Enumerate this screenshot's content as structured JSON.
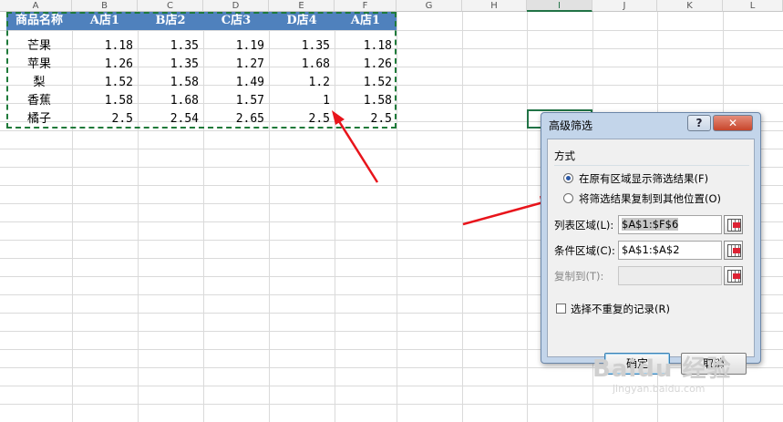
{
  "columns": [
    "A",
    "B",
    "C",
    "D",
    "E",
    "F",
    "G",
    "H",
    "I",
    "J",
    "K",
    "L"
  ],
  "table": {
    "headers": [
      "商品名称",
      "A店1",
      "B店2",
      "C店3",
      "D店4",
      "A店1"
    ],
    "rows": [
      [
        "芒果",
        "1.18",
        "1.35",
        "1.19",
        "1.35",
        "1.18"
      ],
      [
        "苹果",
        "1.26",
        "1.35",
        "1.27",
        "1.68",
        "1.26"
      ],
      [
        "梨",
        "1.52",
        "1.58",
        "1.49",
        "1.2",
        "1.52"
      ],
      [
        "香蕉",
        "1.58",
        "1.68",
        "1.57",
        "1",
        "1.58"
      ],
      [
        "橘子",
        "2.5",
        "2.54",
        "2.65",
        "2.5",
        "2.5"
      ]
    ]
  },
  "dialog": {
    "title": "高级筛选",
    "help": "?",
    "close": "✕",
    "group_label": "方式",
    "option_in_place": "在原有区域显示筛选结果(F)",
    "option_copy": "将筛选结果复制到其他位置(O)",
    "list_range_label": "列表区域(L):",
    "list_range_value": "$A$1:$F$6",
    "criteria_label": "条件区域(C):",
    "criteria_value": "$A$1:$A$2",
    "copy_to_label": "复制到(T):",
    "copy_to_value": "",
    "unique_label": "选择不重复的记录(R)",
    "ok": "确定",
    "cancel": "取消",
    "selected_option": "in_place",
    "unique_checked": false
  },
  "annotation_color": "#e8141b",
  "watermark": {
    "main": "Baidu 经验",
    "sub": "jingyan.baidu.com"
  }
}
